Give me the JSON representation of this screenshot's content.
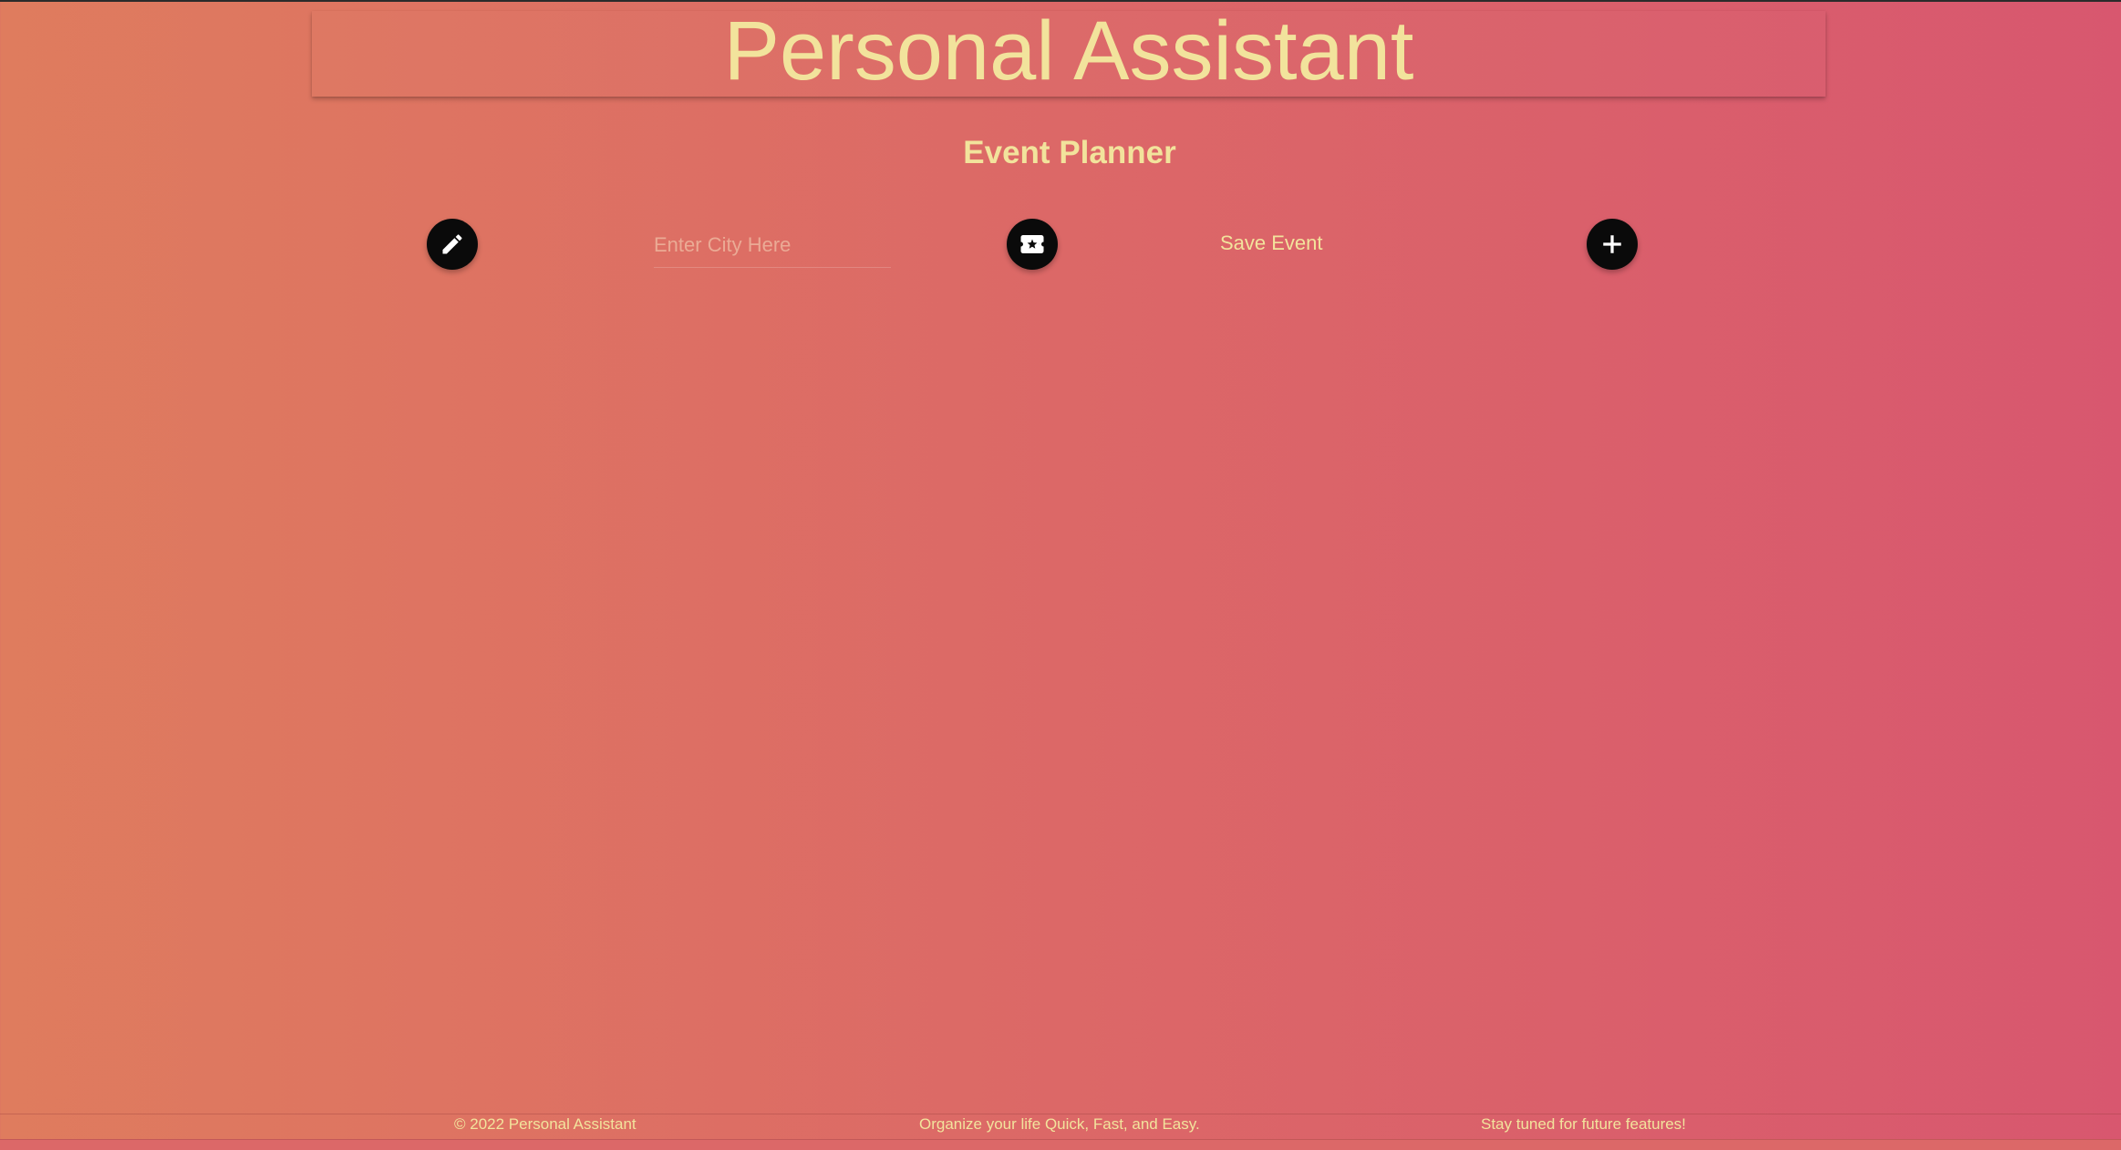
{
  "header": {
    "title": "Personal Assistant"
  },
  "main": {
    "subtitle": "Event Planner",
    "city_input": {
      "placeholder": "Enter City Here",
      "value": ""
    },
    "save_label": "Save Event",
    "buttons": {
      "edit_icon": "pencil-icon",
      "ticket_icon": "ticket-icon",
      "add_icon": "plus-icon"
    }
  },
  "footer": {
    "copyright": "© 2022 Personal Assistant",
    "tagline": "Organize your life Quick, Fast, and Easy.",
    "future": "Stay tuned for future features!"
  },
  "colors": {
    "gradient_start": "#df7c5e",
    "gradient_end": "#d8576f",
    "accent_text": "#f2e39c",
    "button_bg": "#0a0a0a"
  }
}
